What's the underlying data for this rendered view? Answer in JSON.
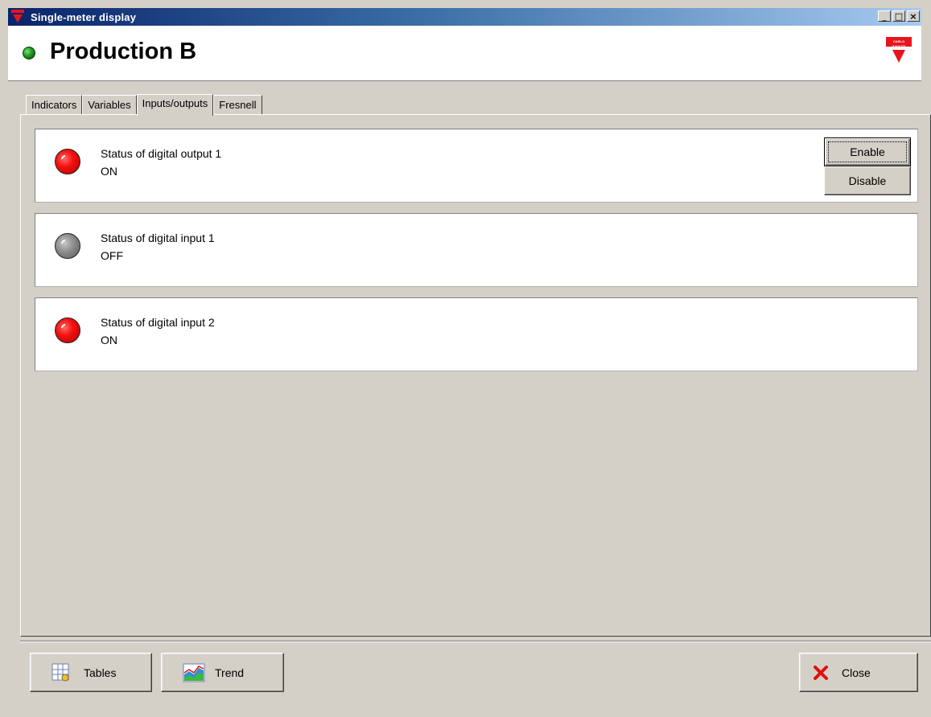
{
  "window": {
    "title": "Single-meter display",
    "controls": {
      "minimize": "_",
      "maximize": "□",
      "close": "×"
    }
  },
  "header": {
    "title": "Production B",
    "status_color": "#1e9a1e",
    "logo_text": "CARLO GAVAZZI"
  },
  "tabs": [
    {
      "label": "Indicators",
      "active": false
    },
    {
      "label": "Variables",
      "active": false
    },
    {
      "label": "Inputs/outputs",
      "active": true
    },
    {
      "label": "Fresnell",
      "active": false
    }
  ],
  "statuses": [
    {
      "label": "Status of digital output 1",
      "value": "ON",
      "state": "on"
    },
    {
      "label": "Status of digital input 1",
      "value": "OFF",
      "state": "off"
    },
    {
      "label": "Status of digital input 2",
      "value": "ON",
      "state": "on"
    }
  ],
  "output_controls": {
    "enable_label": "Enable",
    "disable_label": "Disable"
  },
  "footer": {
    "tables_label": "Tables",
    "trend_label": "Trend",
    "close_label": "Close"
  },
  "colors": {
    "led_on": "#f41010",
    "led_off": "#8a8a8a",
    "brand": "#e8141c"
  }
}
